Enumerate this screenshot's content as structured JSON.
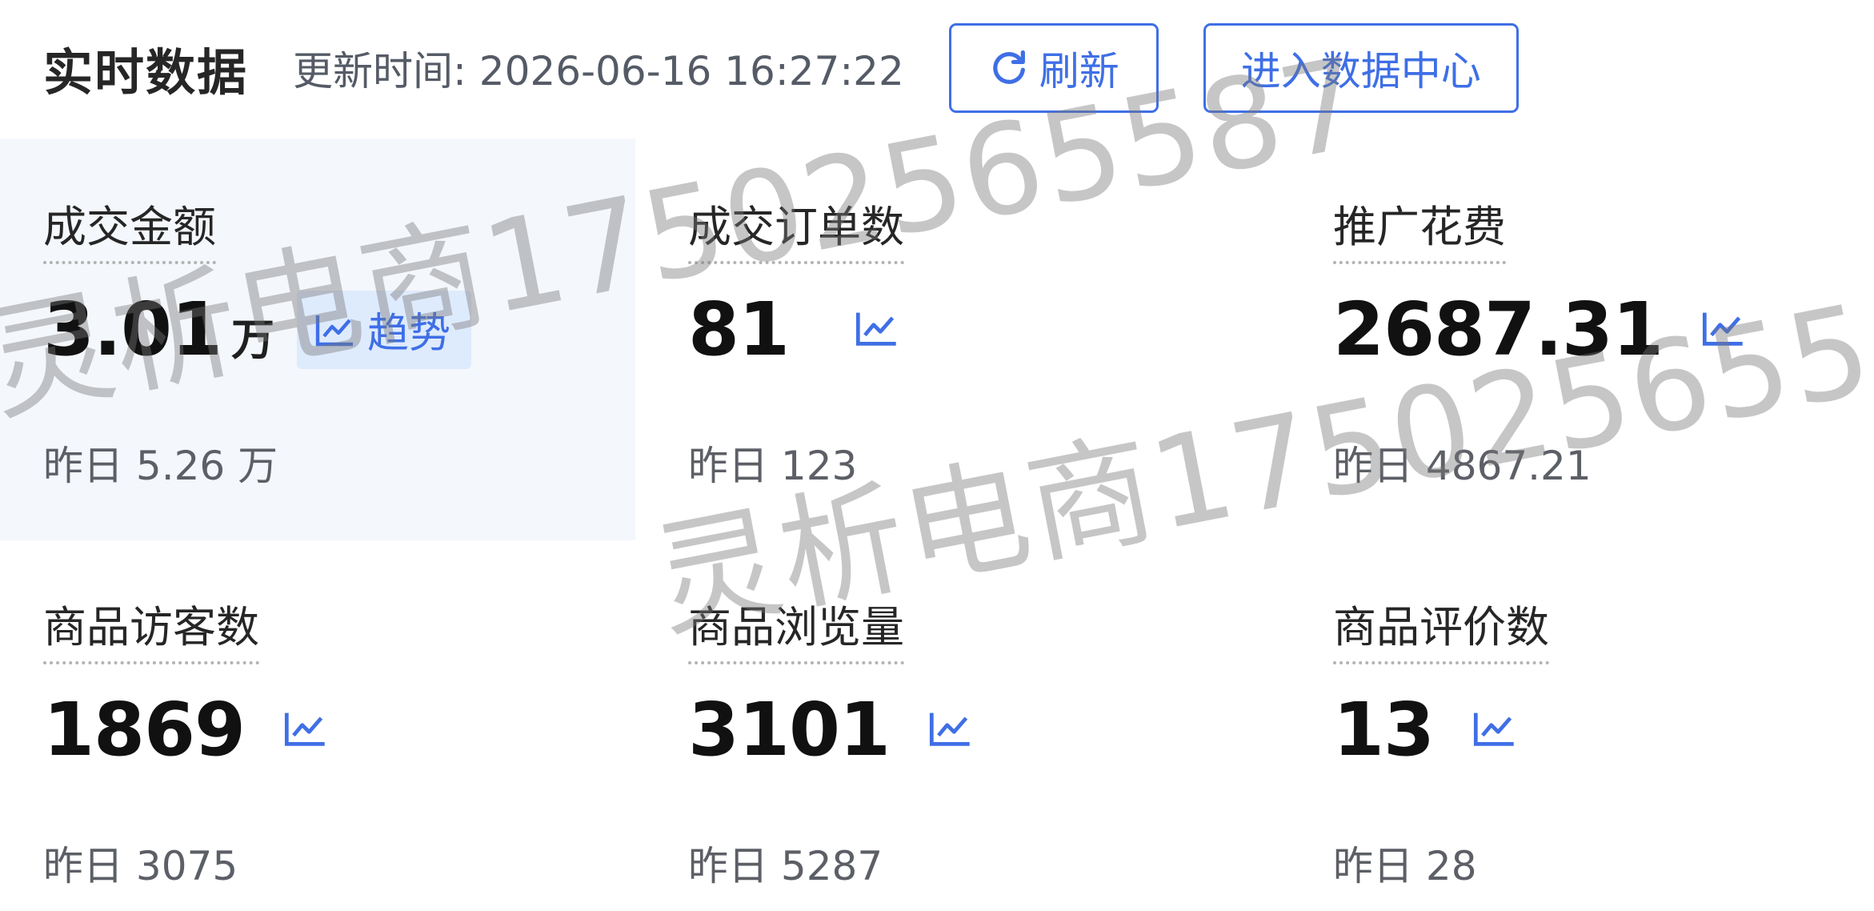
{
  "header": {
    "title": "实时数据",
    "update_time": "更新时间: 2026-06-16 16:27:22",
    "refresh_label": "刷新",
    "data_center_label": "进入数据中心"
  },
  "metrics": [
    {
      "label": "成交金额",
      "value": "3.01",
      "unit": "万",
      "prev": "昨日 5.26 万",
      "trend_label": "趋势",
      "highlighted": true
    },
    {
      "label": "成交订单数",
      "value": "81",
      "prev": "昨日 123"
    },
    {
      "label": "推广花费",
      "value": "2687.31",
      "prev": "昨日 4867.21"
    },
    {
      "label": "商品访客数",
      "value": "1869",
      "prev": "昨日 3075"
    },
    {
      "label": "商品浏览量",
      "value": "3101",
      "prev": "昨日 5287"
    },
    {
      "label": "商品评价数",
      "value": "13",
      "prev": "昨日 28"
    }
  ],
  "watermark": {
    "text": "灵析电商17502565587"
  },
  "colors": {
    "accent": "#3f6fe6",
    "highlight_bg": "#f4f7fc",
    "trend_badge_bg": "#deebfd"
  },
  "icons": {
    "refresh": "refresh-icon",
    "trend": "trend-chart-icon"
  }
}
